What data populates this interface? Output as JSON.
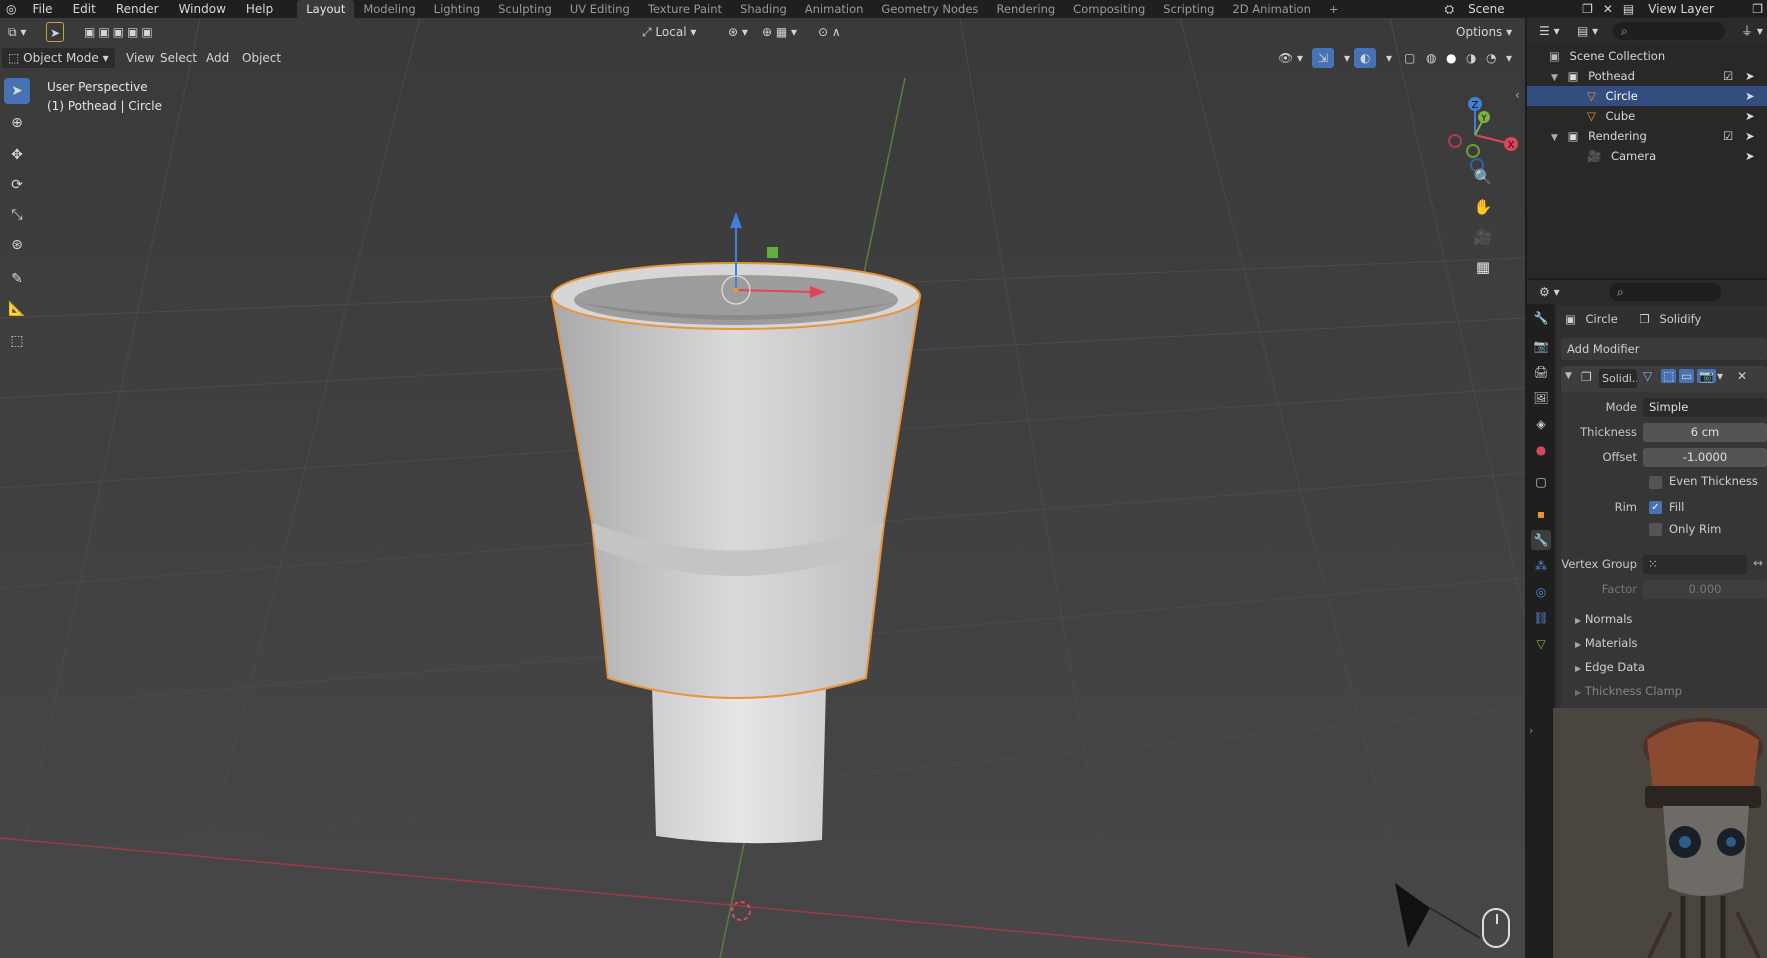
{
  "menu": [
    "File",
    "Edit",
    "Render",
    "Window",
    "Help"
  ],
  "workspaces": [
    "Layout",
    "Modeling",
    "Lighting",
    "Sculpting",
    "UV Editing",
    "Texture Paint",
    "Shading",
    "Animation",
    "Geometry Nodes",
    "Rendering",
    "Compositing",
    "Scripting",
    "2D Animation"
  ],
  "active_workspace": "Layout",
  "scene_name": "Scene",
  "view_layer": "View Layer",
  "viewport": {
    "mode": "Object Mode",
    "menus": [
      "View",
      "Select",
      "Add",
      "Object"
    ],
    "transform_orientation": "Local",
    "options_label": "Options",
    "overlay_title": "User Perspective",
    "overlay_subtitle": "(1) Pothead | Circle",
    "gizmo_axes": {
      "x": "X",
      "y": "Y",
      "z": "Z"
    }
  },
  "outliner": {
    "root": "Scene Collection",
    "rows": [
      {
        "label": "Pothead",
        "kind": "collection"
      },
      {
        "label": "Circle",
        "kind": "mesh",
        "selected": true
      },
      {
        "label": "Cube",
        "kind": "mesh"
      },
      {
        "label": "Rendering",
        "kind": "collection"
      },
      {
        "label": "Camera",
        "kind": "camera"
      }
    ]
  },
  "properties": {
    "object_name": "Circle",
    "modifier_crumb": "Solidify",
    "add_modifier": "Add Modifier",
    "modifier_name": "Solidi...",
    "mode_label": "Mode",
    "mode_value": "Simple",
    "thickness_label": "Thickness",
    "thickness_value": "6 cm",
    "offset_label": "Offset",
    "offset_value": "-1.0000",
    "even_thickness": "Even Thickness",
    "rim_label": "Rim",
    "fill_label": "Fill",
    "only_rim": "Only Rim",
    "vertex_group_label": "Vertex Group",
    "factor_label": "Factor",
    "factor_value": "0.000",
    "subpanels": [
      "Normals",
      "Materials",
      "Edge Data",
      "Thickness Clamp"
    ]
  },
  "colors": {
    "accent": "#4772b3",
    "selection_outline": "#e8943a",
    "axis_x": "#e0445a",
    "axis_y": "#7cb342",
    "axis_z": "#3f7fd6",
    "viewport_bg": "#3d3d3d"
  }
}
